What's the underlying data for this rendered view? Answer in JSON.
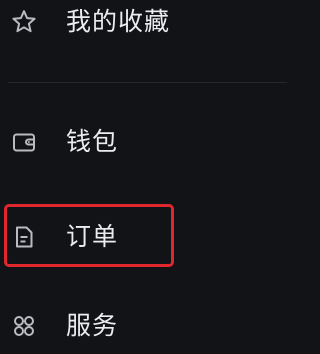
{
  "menu": {
    "items": [
      {
        "id": "favorites",
        "label": "我的收藏",
        "icon": "star-icon"
      },
      {
        "id": "wallet",
        "label": "钱包",
        "icon": "wallet-icon"
      },
      {
        "id": "orders",
        "label": "订单",
        "icon": "document-icon"
      },
      {
        "id": "services",
        "label": "服务",
        "icon": "apps-grid-icon"
      }
    ],
    "highlighted_item": "orders"
  },
  "colors": {
    "background": "#121316",
    "text": "#ececee",
    "icon": "#b9bbc0",
    "divider": "#26282d",
    "highlight_border": "#e0272d"
  }
}
